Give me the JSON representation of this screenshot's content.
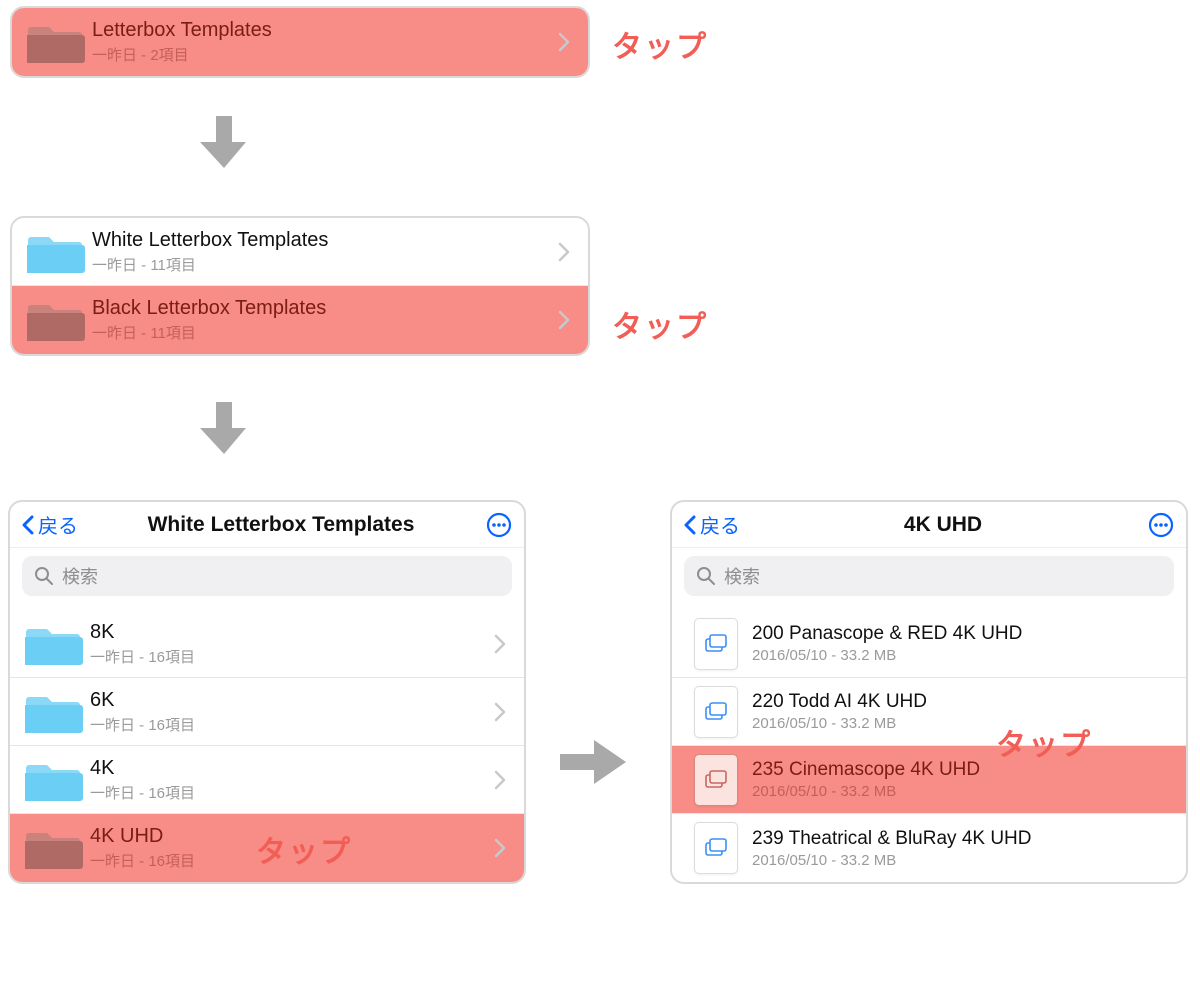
{
  "labels": {
    "tap": "タップ",
    "back": "戻る",
    "search_placeholder": "検索"
  },
  "panel1": {
    "items": [
      {
        "title": "Letterbox Templates",
        "sub": "一昨日 - 2項目",
        "highlight": true
      }
    ]
  },
  "panel2": {
    "items": [
      {
        "title": "White Letterbox Templates",
        "sub": "一昨日 - 11項目",
        "highlight": false
      },
      {
        "title": "Black Letterbox Templates",
        "sub": "一昨日 - 11項目",
        "highlight": true
      }
    ]
  },
  "panel3": {
    "header_title": "White Letterbox Templates",
    "items": [
      {
        "title": "8K",
        "sub": "一昨日 - 16項目",
        "highlight": false
      },
      {
        "title": "6K",
        "sub": "一昨日 - 16項目",
        "highlight": false
      },
      {
        "title": "4K",
        "sub": "一昨日 - 16項目",
        "highlight": false
      },
      {
        "title": "4K UHD",
        "sub": "一昨日 - 16項目",
        "highlight": true
      }
    ]
  },
  "panel4": {
    "header_title": "4K UHD",
    "items": [
      {
        "title": "200 Panascope & RED 4K UHD",
        "sub": "2016/05/10 - 33.2 MB",
        "highlight": false
      },
      {
        "title": "220 Todd AI 4K UHD",
        "sub": "2016/05/10 - 33.2 MB",
        "highlight": false
      },
      {
        "title": "235 Cinemascope 4K UHD",
        "sub": "2016/05/10 - 33.2 MB",
        "highlight": true
      },
      {
        "title": "239 Theatrical & BluRay 4K UHD",
        "sub": "2016/05/10 - 33.2 MB",
        "highlight": false
      }
    ]
  }
}
